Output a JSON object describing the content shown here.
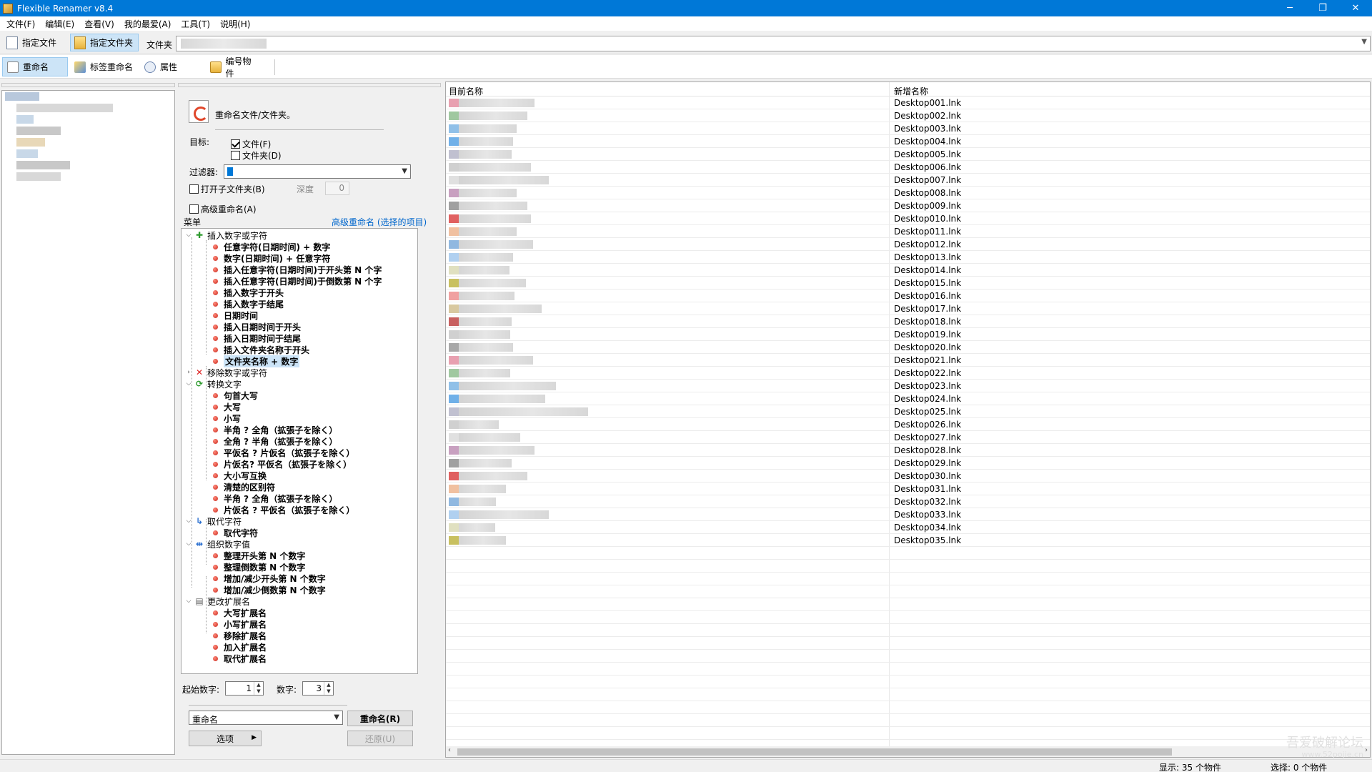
{
  "window": {
    "title": "Flexible Renamer v8.4",
    "controls": [
      "─",
      "❐",
      "✕"
    ]
  },
  "menu": [
    "文件(F)",
    "编辑(E)",
    "查看(V)",
    "我的最爱(A)",
    "工具(T)",
    "说明(H)"
  ],
  "toolbar": {
    "specify_file": "指定文件",
    "specify_folder": "指定文件夹",
    "folder_label": "文件夹"
  },
  "tabs": {
    "rename": "重命名",
    "tag_rename": "标签重命名",
    "attributes": "属性",
    "numbering": "编号物件"
  },
  "options": {
    "section_title": "重命名文件/文件夹。",
    "target_label": "目标:",
    "file_checkbox": "文件(F)",
    "folder_checkbox": "文件夹(D)",
    "filter_label": "过滤器:",
    "open_subfolders": "打开子文件夹(B)",
    "depth_label": "深度",
    "depth_value": "0",
    "advanced_rename": "高级重命名(A)",
    "menu_label": "菜单",
    "advanced_link": "高级重命名 (选择的项目)"
  },
  "tree": {
    "cat_insert": "插入数字或字符",
    "insert_items": [
      "任意字符(日期时间) + 数字",
      "数字(日期时间) + 任意字符",
      "插入任意字符(日期时间)于开头第 N 个字",
      "插入任意字符(日期时间)于倒数第 N 个字",
      "插入数字于开头",
      "插入数字于结尾",
      "日期时间",
      "插入日期时间于开头",
      "插入日期时间于结尾",
      "插入文件夹名称于开头",
      "文件夹名称 + 数字"
    ],
    "cat_remove": "移除数字或字符",
    "cat_convert": "转换文字",
    "convert_items": [
      "句首大写",
      "大写",
      "小写",
      "半角 ? 全角（拡張子を除く）",
      "全角 ? 半角（拡張子を除く）",
      "平仮名 ? 片仮名（拡張子を除く）",
      "片仮名? 平仮名（拡張子を除く）",
      "大小写互换",
      "清楚的区别符",
      "半角 ? 全角（拡張子を除く）",
      "片仮名 ? 平仮名（拡張子を除く）"
    ],
    "cat_replace": "取代字符",
    "replace_items": [
      "取代字符"
    ],
    "cat_organize": "组织数字值",
    "organize_items": [
      "整理开头第 N 个数字",
      "整理倒数第 N 个数字",
      "增加/减少开头第 N 个数字",
      "增加/减少倒数第 N 个数字"
    ],
    "cat_ext": "更改扩展名",
    "ext_items": [
      "大写扩展名",
      "小写扩展名",
      "移除扩展名",
      "加入扩展名",
      "取代扩展名"
    ]
  },
  "bottom": {
    "start_label": "起始数字:",
    "start_value": "1",
    "digits_label": "数字:",
    "digits_value": "3",
    "mode_value": "重命名",
    "rename_button": "重命名(R)",
    "options_button": "选项",
    "undo_button": "还原(U)"
  },
  "list": {
    "col_current": "目前名称",
    "col_new": "新增名称",
    "new_names": [
      "Desktop001.lnk",
      "Desktop002.lnk",
      "Desktop003.lnk",
      "Desktop004.lnk",
      "Desktop005.lnk",
      "Desktop006.lnk",
      "Desktop007.lnk",
      "Desktop008.lnk",
      "Desktop009.lnk",
      "Desktop010.lnk",
      "Desktop011.lnk",
      "Desktop012.lnk",
      "Desktop013.lnk",
      "Desktop014.lnk",
      "Desktop015.lnk",
      "Desktop016.lnk",
      "Desktop017.lnk",
      "Desktop018.lnk",
      "Desktop019.lnk",
      "Desktop020.lnk",
      "Desktop021.lnk",
      "Desktop022.lnk",
      "Desktop023.lnk",
      "Desktop024.lnk",
      "Desktop025.lnk",
      "Desktop026.lnk",
      "Desktop027.lnk",
      "Desktop028.lnk",
      "Desktop029.lnk",
      "Desktop030.lnk",
      "Desktop031.lnk",
      "Desktop032.lnk",
      "Desktop033.lnk",
      "Desktop034.lnk",
      "Desktop035.lnk"
    ]
  },
  "status": {
    "display": "显示:    35 个物件",
    "selected": "选择:    0 个物件"
  },
  "watermark": {
    "line1": "吾爱破解论坛",
    "line2": "www.52pojie.cn"
  },
  "colors": {
    "titlebar": "#0078d7",
    "selection": "#cce4f7",
    "link": "#0066cc",
    "bullet": "#c8281e"
  }
}
